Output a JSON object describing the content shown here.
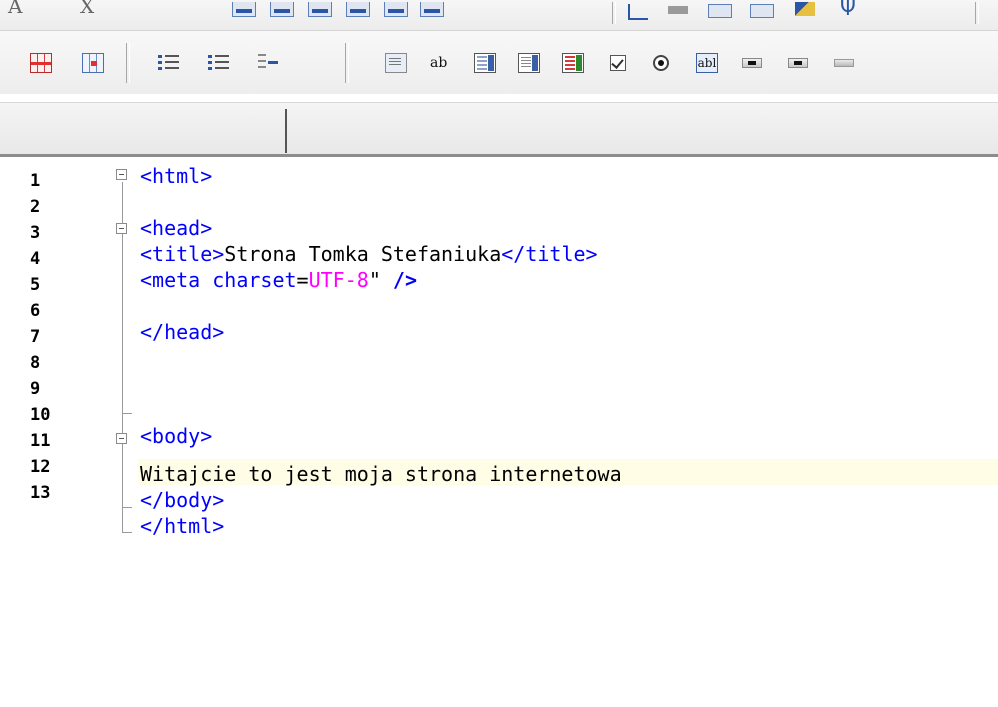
{
  "line_numbers": [
    "1",
    "2",
    "3",
    "4",
    "5",
    "6",
    "7",
    "8",
    "9",
    "10",
    "11",
    "12",
    "13"
  ],
  "code": {
    "l1_tag": "<html>",
    "l3_tag": "<head>",
    "l4_open": "<title>",
    "l4_text": "Strona Tomka Stefaniuka",
    "l4_close": "</title>",
    "l5_open": "<meta ",
    "l5_attr": "charset",
    "l5_eq": "=",
    "l5_val": "UTF-8",
    "l5_quote": "\"",
    "l5_close": " />",
    "l7_tag": "</head>",
    "l10_tag": "<body>",
    "l11_text": "Witajcie to jest moja strona internetowa",
    "l12_tag": "</body>",
    "l13_tag": "</html>"
  },
  "toolbar": {
    "top_glyph_1": "A",
    "top_glyph_2": "X",
    "ab_label": "ab",
    "ab_box_label": "abl"
  }
}
